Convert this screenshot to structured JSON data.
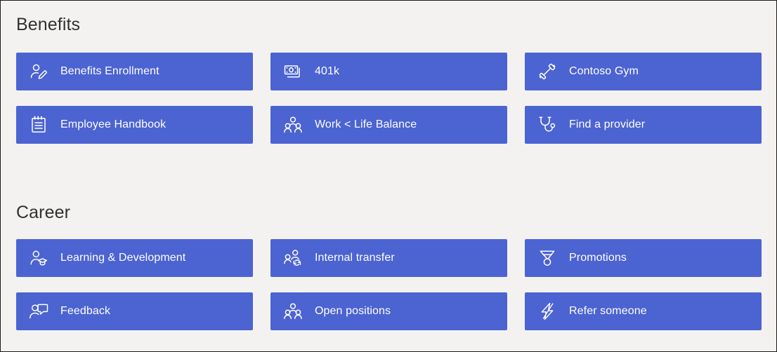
{
  "theme": {
    "page_background": "#f3f2f1",
    "tile_background": "#4c63d2",
    "tile_text": "#ffffff",
    "heading_text": "#323130",
    "border": "#1a1a1a"
  },
  "sections": [
    {
      "id": "benefits",
      "heading": "Benefits",
      "tiles": [
        {
          "label": "Benefits Enrollment",
          "icon": "person-edit-icon"
        },
        {
          "label": "401k",
          "icon": "banknote-icon"
        },
        {
          "label": "Contoso Gym",
          "icon": "dumbbell-icon"
        },
        {
          "label": "Employee Handbook",
          "icon": "notepad-icon"
        },
        {
          "label": "Work < Life Balance",
          "icon": "people-group-icon"
        },
        {
          "label": "Find a provider",
          "icon": "stethoscope-icon"
        }
      ]
    },
    {
      "id": "career",
      "heading": "Career",
      "tiles": [
        {
          "label": "Learning & Development",
          "icon": "person-graduation-cap-icon"
        },
        {
          "label": "Internal transfer",
          "icon": "people-sync-icon"
        },
        {
          "label": "Promotions",
          "icon": "medal-icon"
        },
        {
          "label": "Feedback",
          "icon": "person-feedback-icon"
        },
        {
          "label": "Open positions",
          "icon": "people-group-icon"
        },
        {
          "label": "Refer someone",
          "icon": "lightning-bolt-icon"
        }
      ]
    }
  ]
}
